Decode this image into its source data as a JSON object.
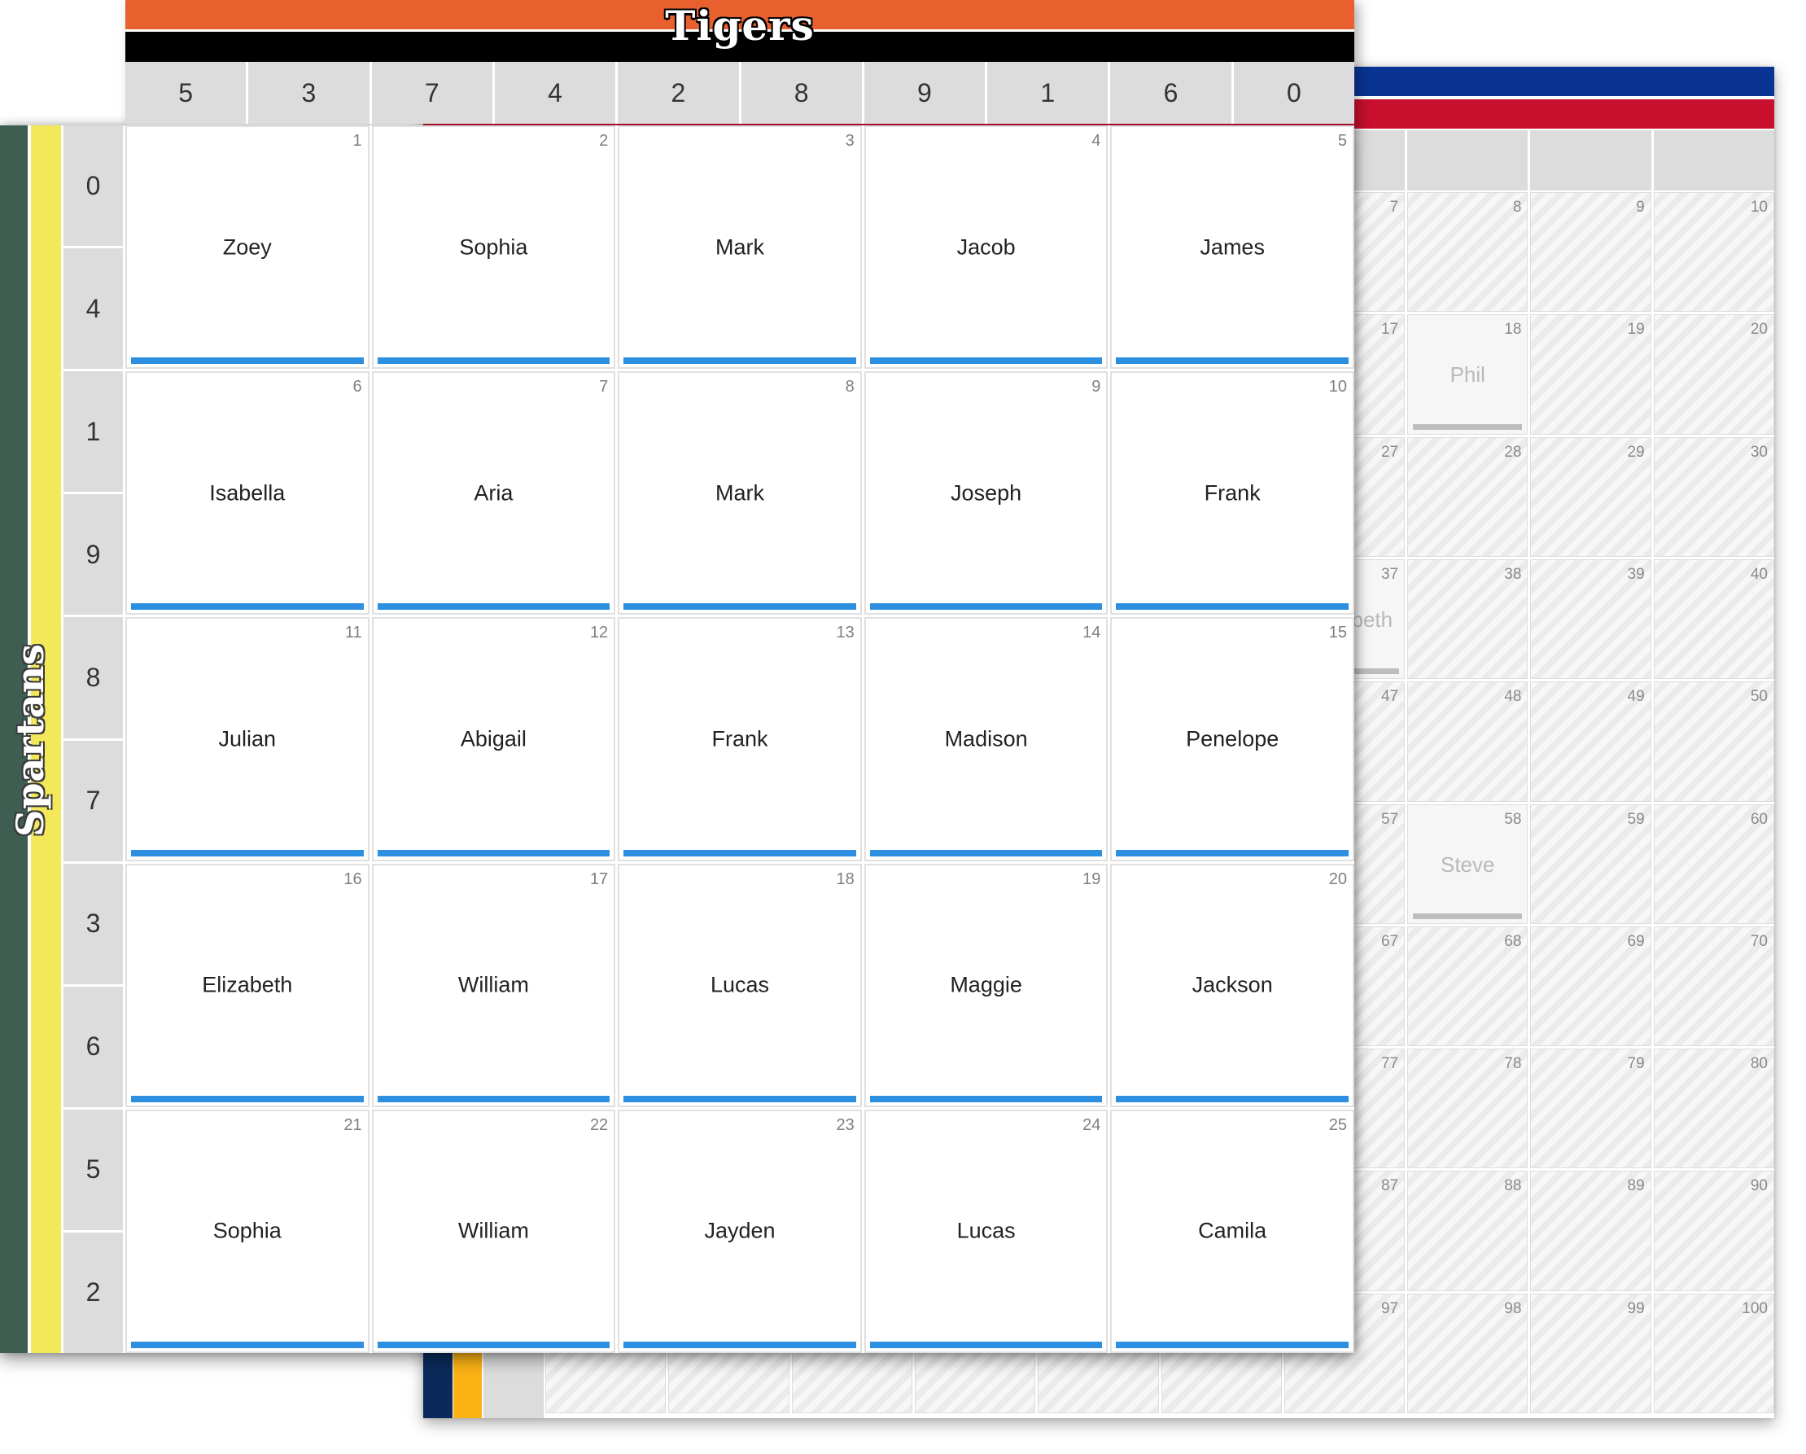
{
  "front_board": {
    "top_team": {
      "name": "Tigers",
      "stripe_color": "#e9602f",
      "band_color": "#000000"
    },
    "side_team": {
      "name": "Spartans",
      "stripe_colors": [
        "#3f5e52",
        "#f2e85a"
      ]
    },
    "column_digits": [
      "5",
      "3",
      "7",
      "4",
      "2",
      "8",
      "9",
      "1",
      "6",
      "0"
    ],
    "row_digits": [
      "0",
      "4",
      "1",
      "9",
      "8",
      "7",
      "3",
      "6",
      "5",
      "2"
    ],
    "squares": [
      {
        "num": "1",
        "name": "Zoey"
      },
      {
        "num": "2",
        "name": "Sophia"
      },
      {
        "num": "3",
        "name": "Mark"
      },
      {
        "num": "4",
        "name": "Jacob"
      },
      {
        "num": "5",
        "name": "James"
      },
      {
        "num": "6",
        "name": "Isabella"
      },
      {
        "num": "7",
        "name": "Aria"
      },
      {
        "num": "8",
        "name": "Mark"
      },
      {
        "num": "9",
        "name": "Joseph"
      },
      {
        "num": "10",
        "name": "Frank"
      },
      {
        "num": "11",
        "name": "Julian"
      },
      {
        "num": "12",
        "name": "Abigail"
      },
      {
        "num": "13",
        "name": "Frank"
      },
      {
        "num": "14",
        "name": "Madison"
      },
      {
        "num": "15",
        "name": "Penelope"
      },
      {
        "num": "16",
        "name": "Elizabeth"
      },
      {
        "num": "17",
        "name": "William"
      },
      {
        "num": "18",
        "name": "Lucas"
      },
      {
        "num": "19",
        "name": "Maggie"
      },
      {
        "num": "20",
        "name": "Jackson"
      },
      {
        "num": "21",
        "name": "Sophia"
      },
      {
        "num": "22",
        "name": "William"
      },
      {
        "num": "23",
        "name": "Jayden"
      },
      {
        "num": "24",
        "name": "Lucas"
      },
      {
        "num": "25",
        "name": "Camila"
      }
    ],
    "claimed_bar_color": "#2d8fe0"
  },
  "back_board": {
    "top_team_colors": [
      "#0a3493",
      "#c8102e"
    ],
    "side_team_colors": [
      "#0b2a5b",
      "#fcb315"
    ],
    "visible_numbers": [
      "7",
      "8",
      "9",
      "10",
      "17",
      "18",
      "19",
      "20",
      "27",
      "28",
      "29",
      "30",
      "37",
      "38",
      "39",
      "40",
      "47",
      "48",
      "49",
      "50",
      "57",
      "58",
      "59",
      "60",
      "67",
      "68",
      "69",
      "70",
      "77",
      "78",
      "79",
      "80",
      "87",
      "88",
      "89",
      "90",
      "97",
      "98",
      "99",
      "100"
    ],
    "visible_names": {
      "18": "Phil",
      "37": "beth",
      "58": "Steve"
    }
  }
}
